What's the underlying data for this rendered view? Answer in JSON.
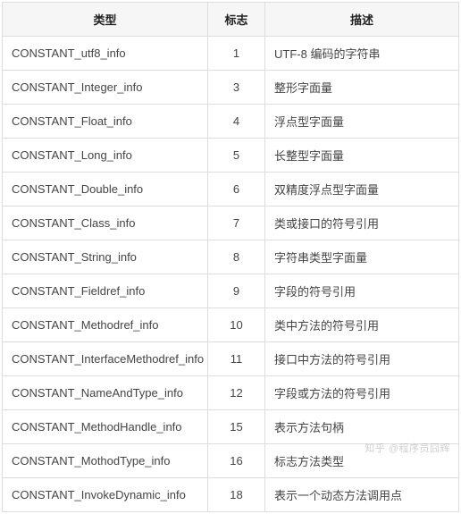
{
  "headers": {
    "type": "类型",
    "flag": "标志",
    "desc": "描述"
  },
  "rows": [
    {
      "type": "CONSTANT_utf8_info",
      "flag": "1",
      "desc": "UTF-8 编码的字符串"
    },
    {
      "type": "CONSTANT_Integer_info",
      "flag": "3",
      "desc": "整形字面量"
    },
    {
      "type": "CONSTANT_Float_info",
      "flag": "4",
      "desc": "浮点型字面量"
    },
    {
      "type": "CONSTANT_Long_info",
      "flag": "5",
      "desc": "长整型字面量"
    },
    {
      "type": "CONSTANT_Double_info",
      "flag": "6",
      "desc": "双精度浮点型字面量"
    },
    {
      "type": "CONSTANT_Class_info",
      "flag": "7",
      "desc": "类或接口的符号引用"
    },
    {
      "type": "CONSTANT_String_info",
      "flag": "8",
      "desc": "字符串类型字面量"
    },
    {
      "type": "CONSTANT_Fieldref_info",
      "flag": "9",
      "desc": "字段的符号引用"
    },
    {
      "type": "CONSTANT_Methodref_info",
      "flag": "10",
      "desc": "类中方法的符号引用"
    },
    {
      "type": "CONSTANT_InterfaceMethodref_info",
      "flag": "11",
      "desc": "接口中方法的符号引用"
    },
    {
      "type": "CONSTANT_NameAndType_info",
      "flag": "12",
      "desc": "字段或方法的符号引用"
    },
    {
      "type": "CONSTANT_MethodHandle_info",
      "flag": "15",
      "desc": "表示方法句柄"
    },
    {
      "type": "CONSTANT_MothodType_info",
      "flag": "16",
      "desc": "标志方法类型"
    },
    {
      "type": "CONSTANT_InvokeDynamic_info",
      "flag": "18",
      "desc": "表示一个动态方法调用点"
    }
  ],
  "watermark": "知乎 @程序员囧辉"
}
